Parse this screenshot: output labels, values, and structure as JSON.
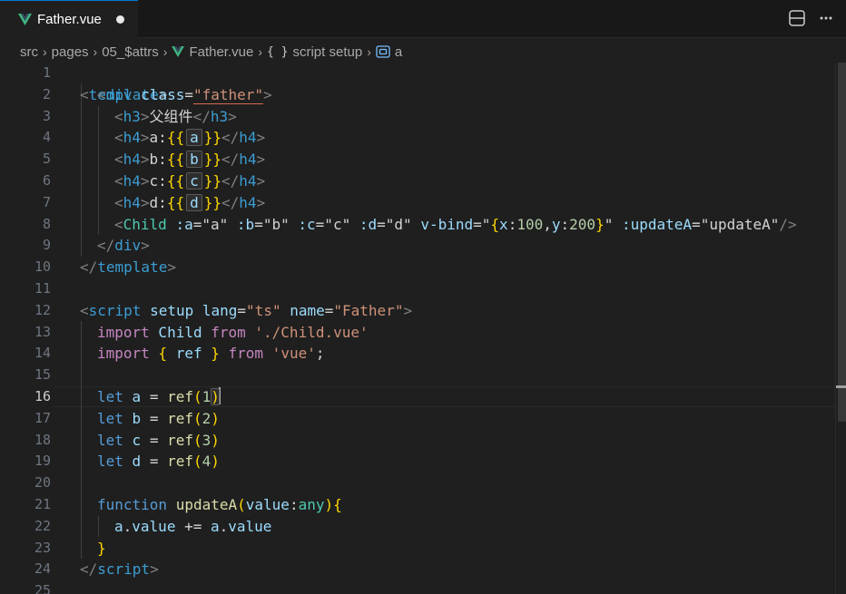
{
  "tab": {
    "title": "Father.vue",
    "dirty": true
  },
  "breadcrumb": {
    "items": [
      "src",
      "pages",
      "05_$attrs",
      "Father.vue",
      "script setup",
      "a"
    ]
  },
  "editor": {
    "active_line": 16,
    "line_numbers": [
      "1",
      "2",
      "3",
      "4",
      "5",
      "6",
      "7",
      "8",
      "9",
      "10",
      "11",
      "12",
      "13",
      "14",
      "15",
      "16",
      "17",
      "18",
      "19",
      "20",
      "21",
      "22",
      "23",
      "24",
      "25"
    ],
    "lines": {
      "l1": {
        "t1": "<",
        "t2": "template",
        "t3": ">"
      },
      "l2": {
        "t1": "<",
        "t2": "div",
        "t3": " class",
        "t4": "=",
        "t5": "\"father\"",
        "t6": ">"
      },
      "l3": {
        "t1": "<",
        "t2": "h3",
        "t3": ">",
        "t4": "父组件",
        "t5": "</",
        "t6": "h3",
        "t7": ">"
      },
      "l4": {
        "t1": "<",
        "t2": "h4",
        "t3": ">",
        "t4": "a:",
        "t5": "{{",
        "t6": "a",
        "t7": "}}",
        "t8": "</",
        "t9": "h4",
        "t10": ">"
      },
      "l5": {
        "t1": "<",
        "t2": "h4",
        "t3": ">",
        "t4": "b:",
        "t5": "{{",
        "t6": "b",
        "t7": "}}",
        "t8": "</",
        "t9": "h4",
        "t10": ">"
      },
      "l6": {
        "t1": "<",
        "t2": "h4",
        "t3": ">",
        "t4": "c:",
        "t5": "{{",
        "t6": "c",
        "t7": "}}",
        "t8": "</",
        "t9": "h4",
        "t10": ">"
      },
      "l7": {
        "t1": "<",
        "t2": "h4",
        "t3": ">",
        "t4": "d:",
        "t5": "{{",
        "t6": "d",
        "t7": "}}",
        "t8": "</",
        "t9": "h4",
        "t10": ">"
      },
      "l8": {
        "t1": "<",
        "t2": "Child",
        "t3": " :a",
        "t4": "=",
        "t5": "\"",
        "t6": "a",
        "t7": "\"",
        "t8": " :b",
        "t9": "=",
        "t10": "\"",
        "t11": "b",
        "t12": "\"",
        "t13": " :c",
        "t14": "=",
        "t15": "\"",
        "t16": "c",
        "t17": "\"",
        "t18": " :d",
        "t19": "=",
        "t20": "\"",
        "t21": "d",
        "t22": "\"",
        "t23": " v-bind",
        "t24": "=",
        "t25": "\"",
        "t26": "{",
        "t27": "x",
        "t28": ":",
        "t29": "100",
        "t30": ",",
        "t31": "y",
        "t32": ":",
        "t33": "200",
        "t34": "}",
        "t35": "\"",
        "t36": " :updateA",
        "t37": "=",
        "t38": "\"",
        "t39": "updateA",
        "t40": "\"",
        "t41": "/>"
      },
      "l9": {
        "t1": "</",
        "t2": "div",
        "t3": ">"
      },
      "l10": {
        "t1": "</",
        "t2": "template",
        "t3": ">"
      },
      "l12": {
        "t1": "<",
        "t2": "script",
        "t3": " setup",
        "t4": " lang",
        "t5": "=",
        "t6": "\"ts\"",
        "t7": " name",
        "t8": "=",
        "t9": "\"Father\"",
        "t10": ">"
      },
      "l13": {
        "t1": "import",
        "t2": " Child ",
        "t3": "from",
        "t4": " './Child.vue'"
      },
      "l14": {
        "t1": "import",
        "t2": " { ",
        "t3": "ref",
        "t4": " } ",
        "t5": "from",
        "t6": " 'vue'",
        "t7": ";"
      },
      "l16": {
        "t1": "let",
        "t2": " a ",
        "t3": "=",
        "t4": " ref",
        "t5": "(",
        "t6": "1",
        "t7": ")"
      },
      "l17": {
        "t1": "let",
        "t2": " b ",
        "t3": "=",
        "t4": " ref",
        "t5": "(",
        "t6": "2",
        "t7": ")"
      },
      "l18": {
        "t1": "let",
        "t2": " c ",
        "t3": "=",
        "t4": " ref",
        "t5": "(",
        "t6": "3",
        "t7": ")"
      },
      "l19": {
        "t1": "let",
        "t2": " d ",
        "t3": "=",
        "t4": " ref",
        "t5": "(",
        "t6": "4",
        "t7": ")"
      },
      "l21": {
        "t1": "function",
        "t2": " updateA",
        "t3": "(",
        "t4": "value",
        "t5": ":",
        "t6": "any",
        "t7": ")",
        "t8": "{"
      },
      "l22": {
        "t1": "a",
        "t2": ".",
        "t3": "value",
        "t4": " += ",
        "t5": "a",
        "t6": ".",
        "t7": "value"
      },
      "l23": {
        "t1": "}"
      },
      "l24": {
        "t1": "</",
        "t2": "script",
        "t3": ">"
      }
    }
  },
  "colors": {
    "accent": "#0078d4",
    "tag": "#3c9dd3",
    "attribute": "#9cdcfe",
    "string": "#ce9178",
    "keyword": "#c586c0",
    "function": "#dcdcaa",
    "bracket_gold": "#ffd700",
    "vue_green": "#41b883"
  }
}
